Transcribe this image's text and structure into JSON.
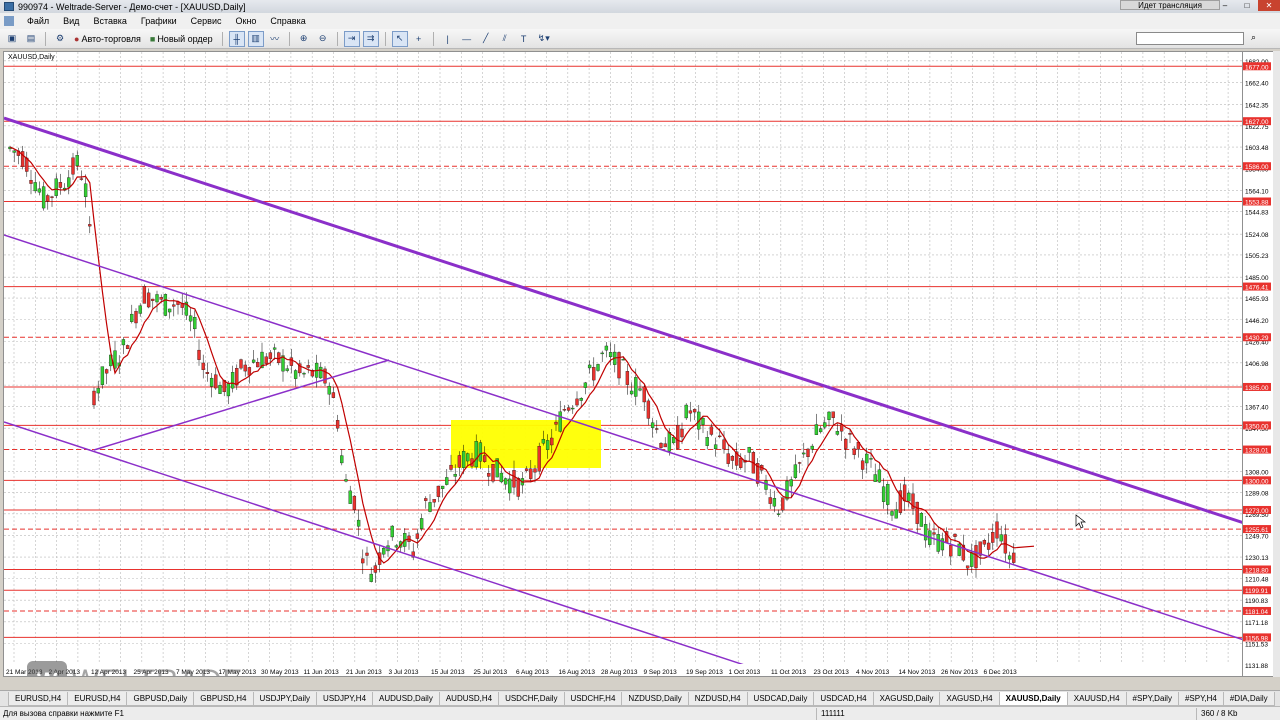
{
  "window": {
    "title": "990974 - Weltrade-Server - Демо-счет - [XAUUSD,Daily]",
    "broadcast_label": "Идет трансляция",
    "controls": [
      "–",
      "□",
      "✕"
    ]
  },
  "menu": [
    "Файл",
    "Вид",
    "Вставка",
    "Графики",
    "Сервис",
    "Окно",
    "Справка"
  ],
  "toolbar": {
    "autotrade_label": "Авто-торговля",
    "new_order_label": "Новый ордер"
  },
  "chart": {
    "symbol_label": "XAUUSD,Daily",
    "price_ticks": [
      "1682.00",
      "1662.40",
      "1642.35",
      "1622.75",
      "1603.48",
      "1584.00",
      "1564.10",
      "1544.83",
      "1524.08",
      "1505.23",
      "1485.00",
      "1465.93",
      "1446.20",
      "1426.40",
      "1406.98",
      "1386.68",
      "1367.40",
      "1347.50",
      "1328.20",
      "1308.00",
      "1289.08",
      "1269.50",
      "1249.70",
      "1230.13",
      "1210.48",
      "1190.83",
      "1171.18",
      "1151.53",
      "1131.88"
    ],
    "level_labels": [
      {
        "price": "1677.00",
        "color": "#e8322e"
      },
      {
        "price": "1627.00",
        "color": "#e8322e"
      },
      {
        "price": "1586.00",
        "color": "#e8322e"
      },
      {
        "price": "1553.88",
        "color": "#e8322e"
      },
      {
        "price": "1476.41",
        "color": "#e8322e"
      },
      {
        "price": "1430.29",
        "color": "#e8322e"
      },
      {
        "price": "1385.00",
        "color": "#e8322e"
      },
      {
        "price": "1350.00",
        "color": "#e8322e"
      },
      {
        "price": "1328.01",
        "color": "#e8322e"
      },
      {
        "price": "1300.00",
        "color": "#e8322e"
      },
      {
        "price": "1273.00",
        "color": "#e8322e"
      },
      {
        "price": "1255.61",
        "color": "#e8322e"
      },
      {
        "price": "1218.80",
        "color": "#e8322e"
      },
      {
        "price": "1199.91",
        "color": "#e8322e"
      },
      {
        "price": "1181.04",
        "color": "#e8322e"
      },
      {
        "price": "1156.98",
        "color": "#e8322e"
      }
    ],
    "date_labels": [
      "21 Mar 2013",
      "2 Apr 2013",
      "12 Apr 2013",
      "25 Apr 2013",
      "7 May 2013",
      "17 May 2013",
      "30 May 2013",
      "11 Jun 2013",
      "21 Jun 2013",
      "3 Jul 2013",
      "15 Jul 2013",
      "25 Jul 2013",
      "6 Aug 2013",
      "16 Aug 2013",
      "28 Aug 2013",
      "9 Sep 2013",
      "19 Sep 2013",
      "1 Oct 2013",
      "11 Oct 2013",
      "23 Oct 2013",
      "4 Nov 2013",
      "14 Nov 2013",
      "26 Nov 2013",
      "6 Dec 2013"
    ],
    "colors": {
      "candle_up": "#33cc33",
      "candle_down": "#e8322e",
      "ma": "#c00000",
      "channel": "#8b2fc9",
      "highlight": "#ffff00",
      "grid": "#b9b9b9"
    }
  },
  "watermark": {
    "brand": "WELTRADE"
  },
  "tabs": [
    "EURUSD,H4",
    "EURUSD,H4",
    "GBPUSD,Daily",
    "GBPUSD,H4",
    "USDJPY,Daily",
    "USDJPY,H4",
    "AUDUSD,Daily",
    "AUDUSD,H4",
    "USDCHF,Daily",
    "USDCHF,H4",
    "NZDUSD,Daily",
    "NZDUSD,H4",
    "USDCAD,Daily",
    "USDCAD,H4",
    "XAGUSD,Daily",
    "XAGUSD,H4",
    "XAUUSD,Daily",
    "XAUUSD,H4",
    "#SPY,Daily",
    "#SPY,H4",
    "#DIA,Daily"
  ],
  "active_tab": 16,
  "status": {
    "help": "Для вызова справки нажмите F1",
    "field": "111111",
    "traffic": "360 / 8 Kb"
  }
}
